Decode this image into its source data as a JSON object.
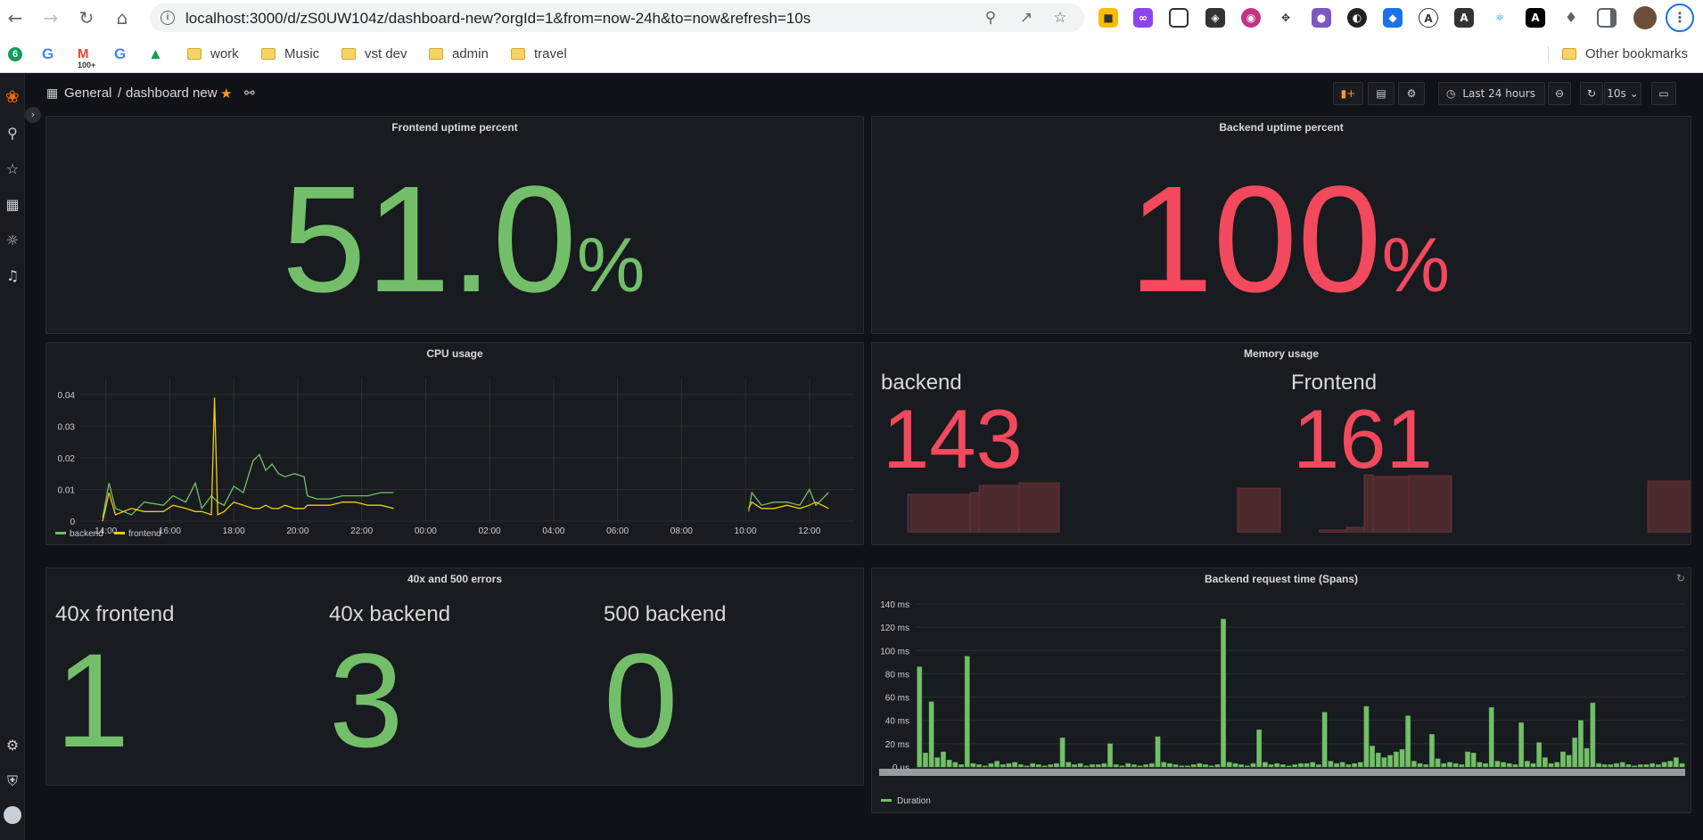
{
  "browser": {
    "url": "localhost:3000/d/zS0UW104z/dashboard-new?orgId=1&from=now-24h&to=now&refresh=10s",
    "bookmarks": [
      {
        "label": "work"
      },
      {
        "label": "Music"
      },
      {
        "label": "vst dev"
      },
      {
        "label": "admin"
      },
      {
        "label": "travel"
      }
    ],
    "other_bookmarks": "Other bookmarks",
    "gmail_badge": "100+"
  },
  "nav": {
    "folder": "General",
    "separator": "/",
    "dashboard": "dashboard new",
    "time_range": "Last 24 hours",
    "refresh": "10s"
  },
  "panels": {
    "frontend_uptime": {
      "title": "Frontend uptime percent",
      "value": "51.0",
      "unit": "%",
      "color": "#73bf69"
    },
    "backend_uptime": {
      "title": "Backend uptime percent",
      "value": "100",
      "unit": "%",
      "color": "#f2495c"
    },
    "cpu": {
      "title": "CPU usage"
    },
    "memory": {
      "title": "Memory usage",
      "backend_label": "backend",
      "backend_value": "143",
      "frontend_label": "Frontend",
      "frontend_value": "161",
      "color": "#f2495c"
    },
    "errors": {
      "title": "40x and 500 errors",
      "items": [
        {
          "label": "40x frontend",
          "value": "1"
        },
        {
          "label": "40x backend",
          "value": "3"
        },
        {
          "label": "500 backend",
          "value": "0"
        }
      ],
      "color": "#73bf69"
    },
    "spans": {
      "title": "Backend request time (Spans)"
    }
  },
  "chart_data": [
    {
      "type": "line",
      "title": "CPU usage",
      "x_ticks": [
        "14:00",
        "16:00",
        "18:00",
        "20:00",
        "22:00",
        "00:00",
        "02:00",
        "04:00",
        "06:00",
        "08:00",
        "10:00",
        "12:00"
      ],
      "y_ticks": [
        "0",
        "0.01",
        "0.02",
        "0.03",
        "0.04"
      ],
      "ylim": [
        0,
        0.045
      ],
      "xlim_hours": [
        13.2,
        37.2
      ],
      "series": [
        {
          "name": "backend",
          "color": "#73bf69",
          "points": [
            [
              15.9,
              0.001
            ],
            [
              16.1,
              0.012
            ],
            [
              16.3,
              0.004
            ],
            [
              16.8,
              0.002
            ],
            [
              17.2,
              0.006
            ],
            [
              17.8,
              0.005
            ],
            [
              18.1,
              0.008
            ],
            [
              18.5,
              0.006
            ],
            [
              18.8,
              0.012
            ],
            [
              19.0,
              0.004
            ],
            [
              19.3,
              0.008
            ],
            [
              19.5,
              0.006
            ],
            [
              19.7,
              0.005
            ],
            [
              20.0,
              0.011
            ],
            [
              20.3,
              0.009
            ],
            [
              20.6,
              0.019
            ],
            [
              20.8,
              0.021
            ],
            [
              21.0,
              0.016
            ],
            [
              21.2,
              0.018
            ],
            [
              21.4,
              0.015
            ],
            [
              21.6,
              0.014
            ],
            [
              21.9,
              0.015
            ],
            [
              22.2,
              0.014
            ],
            [
              22.3,
              0.008
            ],
            [
              22.6,
              0.007
            ],
            [
              23.0,
              0.007
            ],
            [
              23.4,
              0.008
            ],
            [
              23.8,
              0.008
            ],
            [
              24.2,
              0.008
            ],
            [
              24.6,
              0.009
            ],
            [
              25.0,
              0.009
            ],
            [
              36.1,
              0.003
            ],
            [
              36.2,
              0.009
            ],
            [
              36.5,
              0.005
            ],
            [
              36.9,
              0.006
            ],
            [
              37.3,
              0.006
            ],
            [
              37.7,
              0.005
            ],
            [
              38.0,
              0.01
            ],
            [
              38.2,
              0.005
            ],
            [
              38.6,
              0.009
            ]
          ]
        },
        {
          "name": "frontend",
          "color": "#f2cc0c",
          "points": [
            [
              15.9,
              0.0
            ],
            [
              16.1,
              0.009
            ],
            [
              16.3,
              0.002
            ],
            [
              16.8,
              0.004
            ],
            [
              17.2,
              0.003
            ],
            [
              17.8,
              0.003
            ],
            [
              18.1,
              0.005
            ],
            [
              18.5,
              0.004
            ],
            [
              18.8,
              0.003
            ],
            [
              19.0,
              0.003
            ],
            [
              19.3,
              0.002
            ],
            [
              19.4,
              0.039
            ],
            [
              19.5,
              0.002
            ],
            [
              19.7,
              0.003
            ],
            [
              20.0,
              0.006
            ],
            [
              20.3,
              0.005
            ],
            [
              20.6,
              0.004
            ],
            [
              20.8,
              0.004
            ],
            [
              21.0,
              0.005
            ],
            [
              21.2,
              0.004
            ],
            [
              21.4,
              0.004
            ],
            [
              21.6,
              0.005
            ],
            [
              21.9,
              0.004
            ],
            [
              22.2,
              0.004
            ],
            [
              22.3,
              0.005
            ],
            [
              22.6,
              0.005
            ],
            [
              23.0,
              0.005
            ],
            [
              23.4,
              0.006
            ],
            [
              23.8,
              0.006
            ],
            [
              24.2,
              0.005
            ],
            [
              24.6,
              0.005
            ],
            [
              25.0,
              0.004
            ],
            [
              36.1,
              0.004
            ],
            [
              36.2,
              0.006
            ],
            [
              36.5,
              0.004
            ],
            [
              36.9,
              0.004
            ],
            [
              37.3,
              0.005
            ],
            [
              37.7,
              0.004
            ],
            [
              38.0,
              0.005
            ],
            [
              38.2,
              0.006
            ],
            [
              38.6,
              0.004
            ]
          ]
        }
      ],
      "legend": "bottom-left",
      "grid": true
    },
    {
      "type": "bar",
      "title": "Backend request time (Spans)",
      "y_unit": "ms",
      "y_ticks": [
        "0 µs",
        "20 ms",
        "40 ms",
        "60 ms",
        "80 ms",
        "100 ms",
        "120 ms",
        "140 ms"
      ],
      "ylim": [
        0,
        140
      ],
      "series": [
        {
          "name": "Duration",
          "color": "#73bf69",
          "values": [
            86,
            12,
            56,
            8,
            13,
            6,
            4,
            2,
            95,
            3,
            2,
            1,
            3,
            5,
            2,
            3,
            4,
            2,
            1,
            3,
            2,
            1,
            2,
            3,
            25,
            4,
            2,
            3,
            1,
            2,
            2,
            3,
            20,
            2,
            1,
            3,
            2,
            1,
            2,
            3,
            26,
            4,
            3,
            2,
            1,
            1,
            2,
            3,
            2,
            1,
            2,
            127,
            4,
            3,
            2,
            1,
            3,
            32,
            4,
            2,
            3,
            2,
            1,
            2,
            3,
            3,
            4,
            2,
            47,
            5,
            3,
            4,
            2,
            3,
            4,
            52,
            18,
            12,
            8,
            10,
            13,
            15,
            44,
            5,
            3,
            2,
            28,
            7,
            3,
            4,
            3,
            2,
            13,
            12,
            4,
            3,
            51,
            5,
            4,
            3,
            2,
            38,
            5,
            3,
            21,
            8,
            3,
            4,
            13,
            10,
            25,
            40,
            16,
            55,
            3,
            2,
            2,
            3,
            4,
            2,
            1,
            2,
            2,
            3,
            2,
            4,
            5,
            8,
            3
          ]
        }
      ],
      "legend": "bottom-left",
      "grid": true
    },
    {
      "type": "area",
      "title": "Memory usage sparklines",
      "series": [
        {
          "name": "backend",
          "segments": [
            [
              0.08,
              0.3
            ],
            [
              0.6,
              0.65
            ]
          ]
        },
        {
          "name": "Frontend",
          "segments": [
            [
              0.22,
              0.43
            ],
            [
              0.83,
              0.99
            ]
          ]
        }
      ]
    }
  ]
}
